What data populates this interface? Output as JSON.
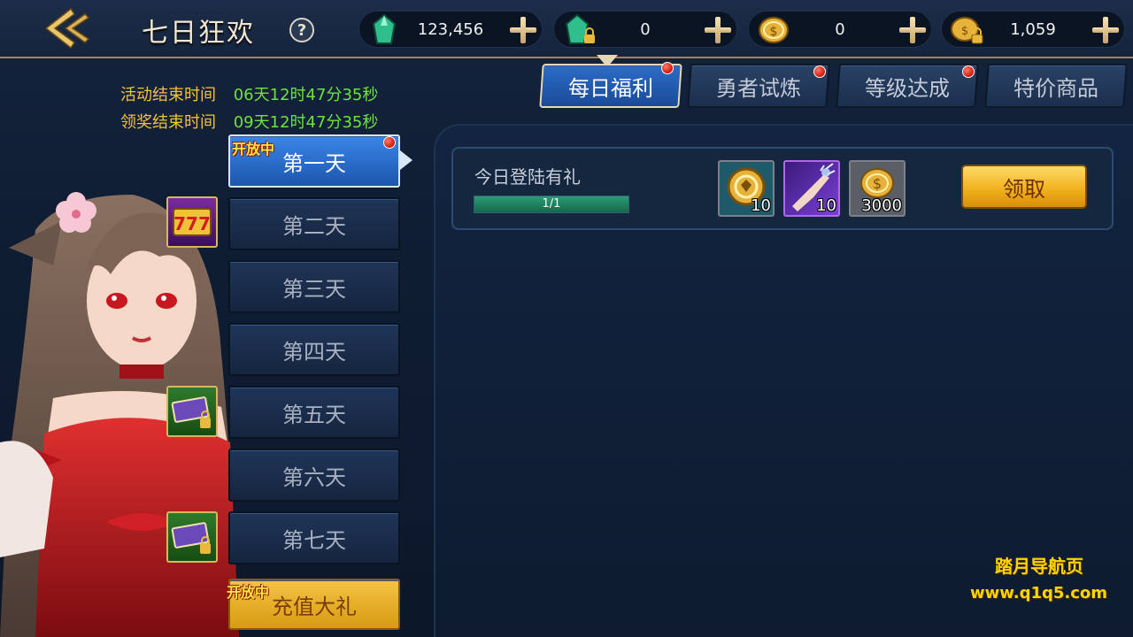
{
  "header": {
    "title": "七日狂欢",
    "help": "?",
    "currencies": [
      {
        "icon": "green-crystal-icon",
        "value": "123,456"
      },
      {
        "icon": "locked-green-crystal-icon",
        "value": "0"
      },
      {
        "icon": "gold-coin-icon",
        "value": "0"
      },
      {
        "icon": "locked-gold-coin-icon",
        "value": "1,059"
      }
    ]
  },
  "tabs": [
    {
      "label": "每日福利",
      "active": true,
      "badge": true
    },
    {
      "label": "勇者试炼",
      "active": false,
      "badge": true
    },
    {
      "label": "等级达成",
      "active": false,
      "badge": true
    },
    {
      "label": "特价商品",
      "active": false,
      "badge": false
    }
  ],
  "timers": {
    "event_end_label": "活动结束时间",
    "event_end_value": "06天12时47分35秒",
    "claim_end_label": "领奖结束时间",
    "claim_end_value": "09天12时47分35秒"
  },
  "days": [
    {
      "label": "第一天",
      "active": true,
      "open_tag": "开放中",
      "badge": true
    },
    {
      "label": "第二天",
      "reward_icon": "slot-777-icon"
    },
    {
      "label": "第三天"
    },
    {
      "label": "第四天"
    },
    {
      "label": "第五天",
      "reward_icon": "ticket-locked-icon"
    },
    {
      "label": "第六天"
    },
    {
      "label": "第七天",
      "reward_icon": "ticket-locked-icon"
    },
    {
      "label": "充值大礼",
      "open_tag": "开放中"
    }
  ],
  "task": {
    "title": "今日登陆有礼",
    "progress_text": "1/1",
    "progress_fraction": 1.0,
    "rewards": [
      {
        "icon": "gold-medal-icon",
        "count": "10"
      },
      {
        "icon": "magic-hand-icon",
        "count": "10"
      },
      {
        "icon": "gold-coin-icon",
        "count": "3000"
      }
    ],
    "claim_label": "领取"
  },
  "watermark": {
    "line1": "踏月导航页",
    "line2": "www.q1q5.com"
  },
  "colors": {
    "accent_gold": "#f1c23a",
    "timer_green": "#6ee23c",
    "tab_active": "#2d6cc8"
  }
}
